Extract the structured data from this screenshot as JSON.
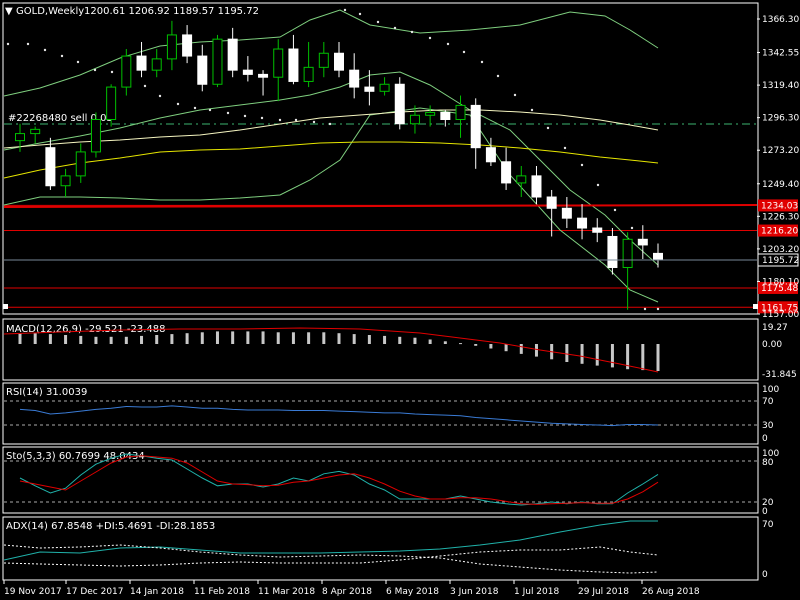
{
  "header": {
    "symbol": "GOLD,Weekly",
    "ohlc": "1200.61 1206.92 1189.57 1195.72"
  },
  "trade_label": "#22268480 sell 0.05",
  "price_axis": {
    "ticks": [
      "1366.30",
      "1342.55",
      "1319.40",
      "1296.30",
      "1273.20",
      "1249.40",
      "1226.30",
      "1203.20",
      "1180.10",
      "1157.00"
    ],
    "current_price": "1195.72"
  },
  "levels": [
    {
      "label": "1234.03",
      "value": 1234.03,
      "color": "#e00000"
    },
    {
      "label": "1216.20",
      "value": 1216.2,
      "color": "#e00000"
    },
    {
      "label": "1175.48",
      "value": 1175.48,
      "color": "#e00000"
    },
    {
      "label": "1161.75",
      "value": 1161.75,
      "color": "#e00000"
    }
  ],
  "indicators": {
    "macd": {
      "label": "MACD(12,26,9) -29.521 -23.488",
      "ticks": [
        "19.27",
        "0.00",
        "-31.845"
      ]
    },
    "rsi": {
      "label": "RSI(14) 31.0039",
      "ticks": [
        "100",
        "70",
        "30",
        "0"
      ]
    },
    "sto": {
      "label": "Sto(5,3,3) 60.7699 48.0434",
      "ticks": [
        "100",
        "80",
        "20",
        "0"
      ]
    },
    "adx": {
      "label": "ADX(14) 67.8548 +DI:5.4691 -DI:28.1853",
      "ticks": [
        "70",
        "0"
      ]
    }
  },
  "date_axis": [
    "19 Nov 2017",
    "17 Dec 2017",
    "14 Jan 2018",
    "11 Feb 2018",
    "11 Mar 2018",
    "8 Apr 2018",
    "6 May 2018",
    "3 Jun 2018",
    "1 Jul 2018",
    "29 Jul 2018",
    "26 Aug 2018"
  ],
  "chart_data": {
    "type": "candlestick",
    "ylim": [
      1157,
      1375
    ],
    "candles": [
      [
        1280,
        1292,
        1272,
        1285
      ],
      [
        1285,
        1290,
        1278,
        1288
      ],
      [
        1275,
        1282,
        1245,
        1248
      ],
      [
        1248,
        1260,
        1240,
        1255
      ],
      [
        1255,
        1278,
        1250,
        1272
      ],
      [
        1272,
        1300,
        1268,
        1295
      ],
      [
        1295,
        1320,
        1290,
        1318
      ],
      [
        1318,
        1345,
        1312,
        1340
      ],
      [
        1340,
        1350,
        1325,
        1330
      ],
      [
        1330,
        1345,
        1325,
        1338
      ],
      [
        1338,
        1365,
        1330,
        1355
      ],
      [
        1355,
        1362,
        1335,
        1340
      ],
      [
        1340,
        1348,
        1315,
        1320
      ],
      [
        1320,
        1355,
        1318,
        1352
      ],
      [
        1352,
        1360,
        1325,
        1330
      ],
      [
        1330,
        1340,
        1322,
        1327
      ],
      [
        1327,
        1330,
        1312,
        1325
      ],
      [
        1325,
        1352,
        1308,
        1345
      ],
      [
        1345,
        1355,
        1320,
        1322
      ],
      [
        1322,
        1350,
        1318,
        1332
      ],
      [
        1332,
        1350,
        1325,
        1342
      ],
      [
        1342,
        1350,
        1325,
        1330
      ],
      [
        1330,
        1342,
        1310,
        1318
      ],
      [
        1318,
        1330,
        1305,
        1315
      ],
      [
        1315,
        1325,
        1312,
        1320
      ],
      [
        1320,
        1325,
        1288,
        1292
      ],
      [
        1292,
        1305,
        1285,
        1298
      ],
      [
        1298,
        1305,
        1290,
        1300
      ],
      [
        1300,
        1302,
        1290,
        1295
      ],
      [
        1295,
        1312,
        1282,
        1305
      ],
      [
        1305,
        1310,
        1260,
        1275
      ],
      [
        1275,
        1282,
        1262,
        1265
      ],
      [
        1265,
        1275,
        1245,
        1250
      ],
      [
        1250,
        1262,
        1240,
        1255
      ],
      [
        1255,
        1262,
        1235,
        1240
      ],
      [
        1240,
        1245,
        1212,
        1232
      ],
      [
        1232,
        1240,
        1218,
        1225
      ],
      [
        1225,
        1235,
        1210,
        1218
      ],
      [
        1218,
        1225,
        1208,
        1215
      ],
      [
        1212,
        1218,
        1185,
        1190
      ],
      [
        1190,
        1215,
        1160,
        1210
      ],
      [
        1210,
        1220,
        1196,
        1206
      ],
      [
        1200,
        1207,
        1190,
        1196
      ]
    ],
    "macd_hist": [
      12,
      12,
      11,
      10,
      9,
      8,
      8,
      8,
      9,
      10,
      11,
      12,
      13,
      14,
      14,
      14,
      14,
      13,
      13,
      13,
      13,
      12,
      11,
      10,
      9,
      8,
      7,
      5,
      3,
      1,
      -2,
      -5,
      -8,
      -11,
      -14,
      -17,
      -20,
      -22,
      -24,
      -26,
      -28,
      -29,
      -30
    ],
    "rsi": [
      58,
      56,
      50,
      52,
      55,
      58,
      60,
      63,
      62,
      62,
      64,
      62,
      60,
      60,
      58,
      57,
      57,
      57,
      56,
      56,
      56,
      55,
      54,
      53,
      52,
      52,
      50,
      49,
      48,
      47,
      44,
      42,
      40,
      38,
      36,
      34,
      33,
      32,
      31,
      30,
      32,
      32,
      31
    ],
    "sto_k": [
      55,
      42,
      30,
      38,
      60,
      78,
      88,
      95,
      92,
      88,
      85,
      70,
      55,
      42,
      45,
      45,
      40,
      45,
      55,
      50,
      62,
      66,
      60,
      45,
      35,
      20,
      20,
      20,
      20,
      25,
      20,
      15,
      12,
      10,
      12,
      15,
      12,
      15,
      12,
      12,
      30,
      45,
      61
    ],
    "sto_d": [
      50,
      45,
      40,
      35,
      50,
      65,
      80,
      90,
      92,
      90,
      88,
      80,
      65,
      50,
      45,
      44,
      42,
      43,
      48,
      50,
      55,
      60,
      62,
      55,
      45,
      33,
      25,
      20,
      20,
      22,
      22,
      20,
      16,
      12,
      11,
      12,
      13,
      14,
      13,
      13,
      20,
      32,
      48
    ]
  }
}
